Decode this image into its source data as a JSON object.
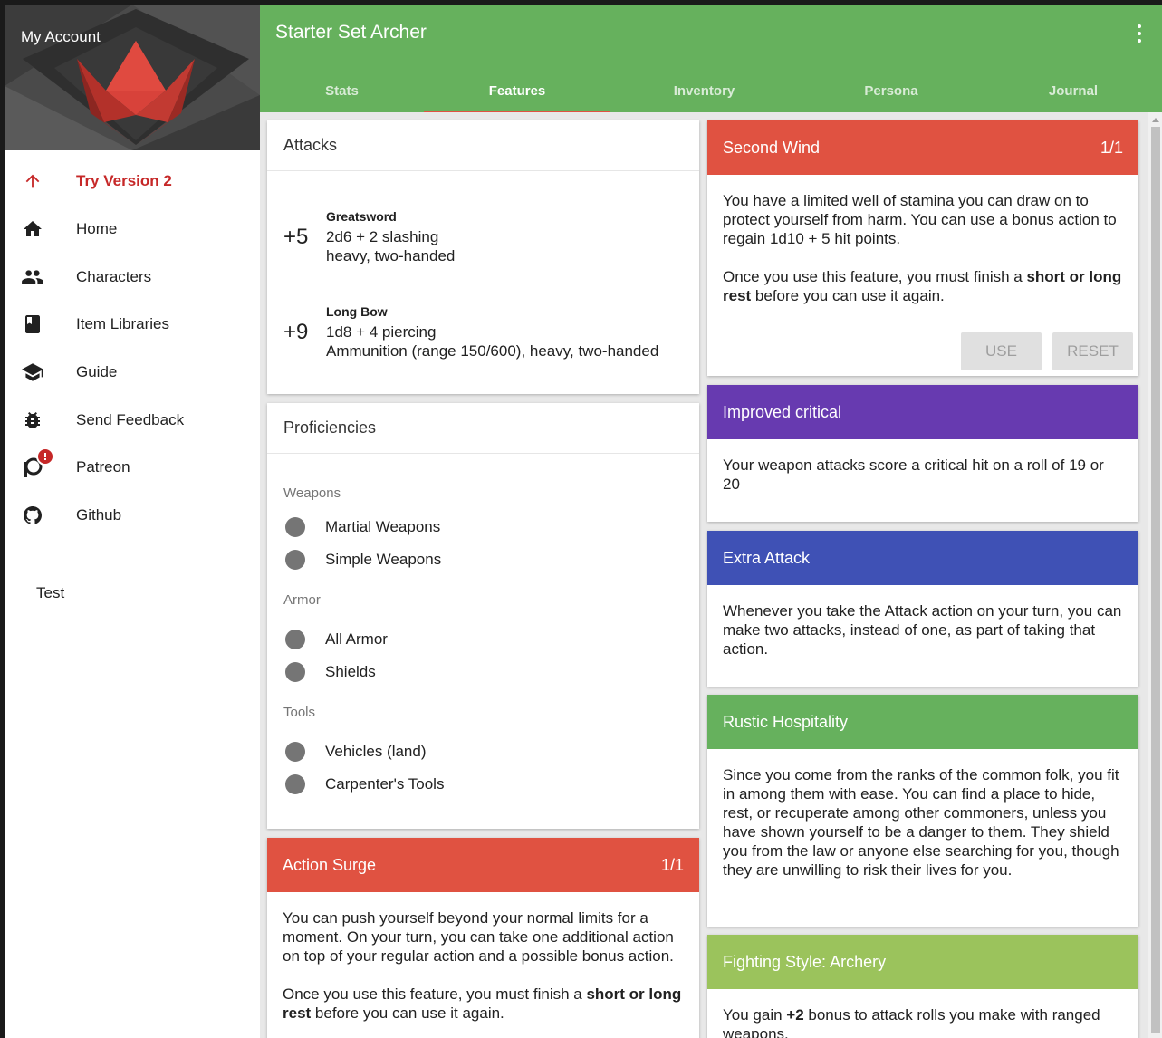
{
  "sidebar": {
    "account_link": "My Account",
    "nav": [
      {
        "label": "Try Version 2",
        "icon": "arrow-up-icon"
      },
      {
        "label": "Home",
        "icon": "home-icon"
      },
      {
        "label": "Characters",
        "icon": "people-icon"
      },
      {
        "label": "Item Libraries",
        "icon": "book-icon"
      },
      {
        "label": "Guide",
        "icon": "school-icon"
      },
      {
        "label": "Send Feedback",
        "icon": "bug-icon"
      },
      {
        "label": "Patreon",
        "icon": "patreon-icon"
      },
      {
        "label": "Github",
        "icon": "github-icon"
      }
    ],
    "sub_item": "Test"
  },
  "appbar": {
    "title": "Starter Set Archer",
    "tabs": [
      {
        "label": "Stats"
      },
      {
        "label": "Features"
      },
      {
        "label": "Inventory"
      },
      {
        "label": "Persona"
      },
      {
        "label": "Journal"
      }
    ],
    "active_tab": "Features"
  },
  "attacks": {
    "title": "Attacks",
    "items": [
      {
        "bonus": "+5",
        "name": "Greatsword",
        "damage": "2d6 + 2 slashing",
        "properties": "heavy, two-handed"
      },
      {
        "bonus": "+9",
        "name": "Long Bow",
        "damage": "1d8 + 4 piercing",
        "properties": "Ammunition (range 150/600), heavy, two-handed"
      }
    ]
  },
  "proficiencies": {
    "title": "Proficiencies",
    "groups": [
      {
        "title": "Weapons",
        "items": [
          "Martial Weapons",
          "Simple Weapons"
        ]
      },
      {
        "title": "Armor",
        "items": [
          "All Armor",
          "Shields"
        ]
      },
      {
        "title": "Tools",
        "items": [
          "Vehicles (land)",
          "Carpenter's Tools"
        ]
      }
    ]
  },
  "features": {
    "second_wind": {
      "title": "Second Wind",
      "uses": "1/1",
      "color": "#e05241",
      "text1": "You have a limited well of stamina you can draw on to protect yourself from harm. You can use a bonus action to regain 1d10 + 5 hit points.",
      "text2_pre": "Once you use this feature, you must finish a ",
      "text2_bold": "short or long rest",
      "text2_post": " before you can use it again.",
      "use_label": "USE",
      "reset_label": "RESET"
    },
    "improved_critical": {
      "title": "Improved critical",
      "color": "#673ab0",
      "text": "Your weapon attacks score a critical hit on a roll of 19 or 20"
    },
    "extra_attack": {
      "title": "Extra Attack",
      "color": "#3f51b5",
      "text": "Whenever you take the Attack action on your turn, you can make two attacks, instead of one, as part of taking that action."
    },
    "rustic_hospitality": {
      "title": "Rustic Hospitality",
      "color": "#66b15d",
      "text": "Since you come from the ranks of the common folk, you fit in among them with ease. You can find a place to hide, rest, or recuperate among other commoners, unless you have shown yourself to be a danger to them. They shield you from the law or anyone else searching for you, though they are unwilling to risk their lives for you."
    },
    "fighting_style": {
      "title": "Fighting Style: Archery",
      "color": "#9bc35c",
      "text_pre": "You gain ",
      "text_bold": "+2",
      "text_post": " bonus to attack rolls you make with ranged weapons."
    },
    "action_surge": {
      "title": "Action Surge",
      "uses": "1/1",
      "color": "#e05241",
      "text1": "You can push yourself beyond your normal limits for a moment. On your turn, you can take one additional action on top of your regular action and a possible bonus action.",
      "text2_pre": "Once you use this feature, you must finish a ",
      "text2_bold": "short or long rest",
      "text2_post": " before you can use it again."
    }
  },
  "colors": {
    "appbar": "#66b15d",
    "accent": "#c62828",
    "tab_indicator": "#e05241"
  }
}
